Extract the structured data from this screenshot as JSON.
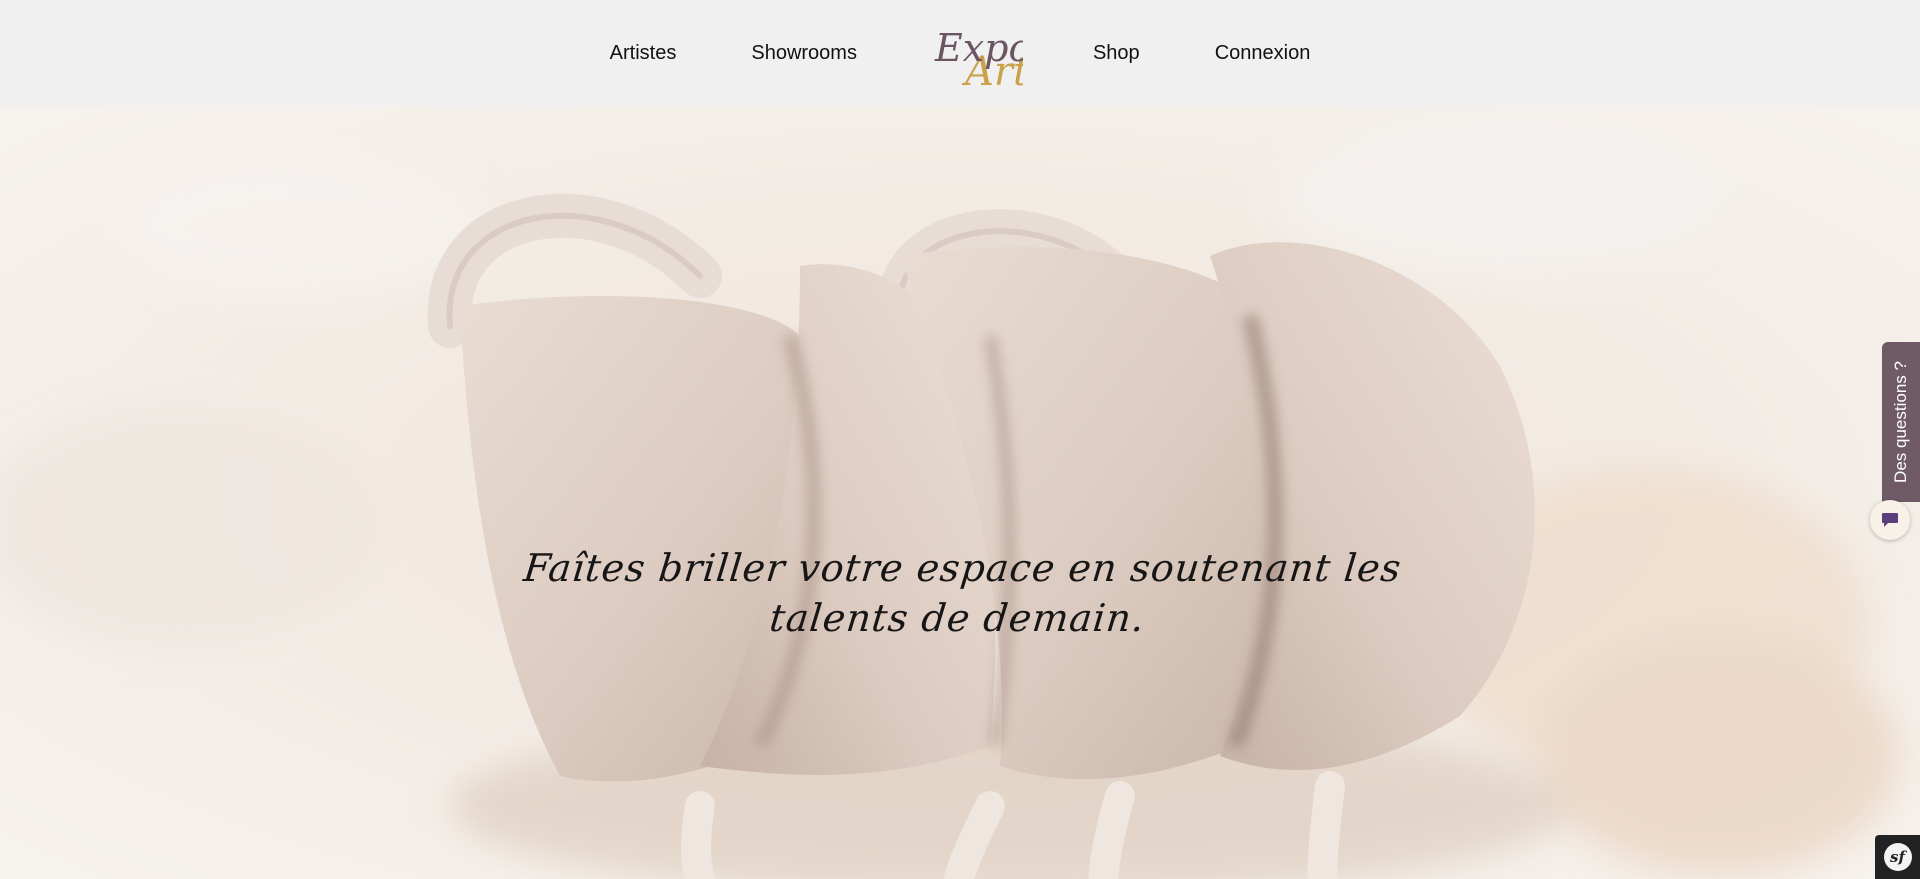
{
  "nav": {
    "items": [
      {
        "label": "Artistes"
      },
      {
        "label": "Showrooms"
      },
      {
        "label": "Shop"
      },
      {
        "label": "Connexion"
      }
    ],
    "logo": {
      "word1": "Expo",
      "word2": "Art",
      "colors": {
        "expo": "#6b5563",
        "art": "#c9a24a"
      }
    }
  },
  "hero": {
    "tagline_line1": "Faîtes briller votre espace en soutenant les",
    "tagline_line2": "talents de demain."
  },
  "help_widget": {
    "tab_label": "Des questions ?",
    "chat_icon": "chat-bubble-icon",
    "accent": "#6f5a66"
  },
  "debug_toolbar": {
    "icon": "symfony-icon",
    "label": "sf"
  }
}
